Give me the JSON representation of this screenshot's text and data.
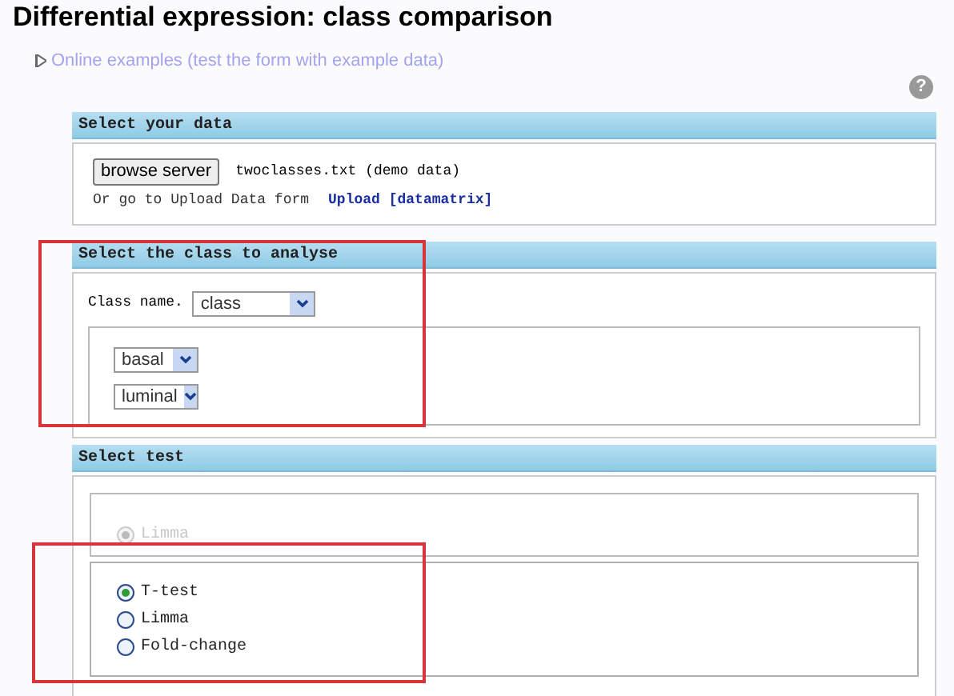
{
  "title": "Differential expression: class comparison",
  "help_icon": "?",
  "examples_link": "Online examples (test the form with example data)",
  "data_section": {
    "header": "Select your data",
    "button": "browse server",
    "file": "twoclasses.txt (demo data)",
    "upload_text": "Or go to Upload Data form",
    "upload_link": "Upload [datamatrix]"
  },
  "class_section": {
    "header": "Select the class to analyse",
    "highlighted": true,
    "class_label": "Class name.",
    "class_value": "class",
    "groups": [
      "basal",
      "luminal"
    ]
  },
  "test_section": {
    "header": "Select test",
    "groups": [
      {
        "highlighted": false,
        "options": [
          {
            "label": "Limma",
            "selected": true,
            "disabled": true
          }
        ]
      },
      {
        "highlighted": true,
        "options": [
          {
            "label": "T-test",
            "selected": true,
            "disabled": false
          },
          {
            "label": "Limma",
            "selected": false,
            "disabled": false
          },
          {
            "label": "Fold-change",
            "selected": false,
            "disabled": false
          }
        ]
      }
    ]
  }
}
